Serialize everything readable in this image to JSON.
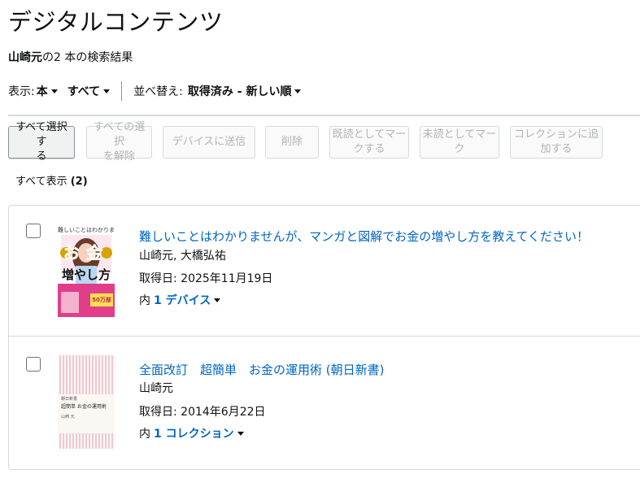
{
  "header": {
    "title": "デジタルコンテンツ",
    "summary_author": "山崎元",
    "summary_rest": "の2 本の検索結果"
  },
  "filters": {
    "display_label": "表示:",
    "type_value": "本",
    "scope_value": "すべて",
    "sort_label": "並べ替え:",
    "sort_value": "取得済み - 新しい順"
  },
  "toolbar": {
    "select_all_l1": "すべて選択す",
    "select_all_l2": "る",
    "deselect_l1": "すべての選択",
    "deselect_l2": "を解除",
    "send_device": "デバイスに送信",
    "delete": "削除",
    "mark_read_l1": "既読としてマー",
    "mark_read_l2": "クする",
    "mark_unread_l1": "未読としてマー",
    "mark_unread_l2": "ク",
    "add_collection_l1": "コレクションに追",
    "add_collection_l2": "加する"
  },
  "show_all": {
    "label": "すべて表示",
    "count": "(2)"
  },
  "items": [
    {
      "title": "難しいことはわかりませんが、マンガと図解でお金の増やし方を教えてください！",
      "author": "山崎元, 大橋弘祐",
      "acquired": "取得日: 2025年11月19日",
      "in_label": "内",
      "location": "1 デバイス",
      "cover": {
        "top_line": "難しいことはわかりませんが",
        "big_chars": "お金",
        "main_text": "増やし方",
        "badge": "50万部"
      }
    },
    {
      "title": "全面改訂　超簡単　お金の運用術 (朝日新書)",
      "author": "山崎元",
      "acquired": "取得日: 2014年6月22日",
      "in_label": "内",
      "location": "1 コレクション",
      "cover": {
        "series": "朝日新書",
        "main_text": "超簡単 お金の運用術",
        "author": "山崎 元"
      }
    }
  ],
  "colors": {
    "link": "#0066c0",
    "border": "#d5d9d9",
    "text": "#0f1111",
    "disabled_text": "#b1b4b4",
    "cover_pink": "#e23d8a",
    "cover_gold": "#d6a300"
  }
}
